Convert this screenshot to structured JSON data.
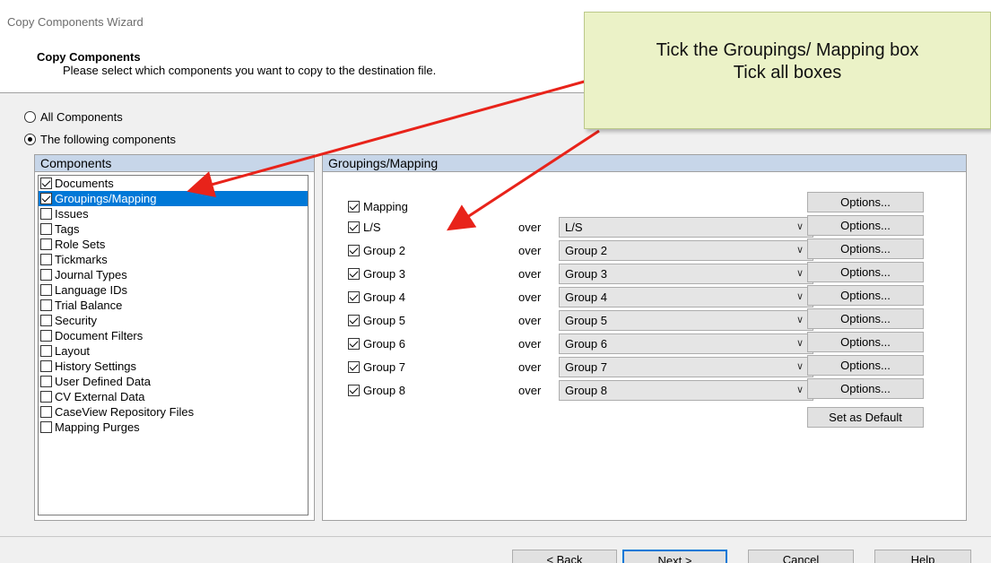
{
  "window": {
    "title": "Copy Components Wizard"
  },
  "header": {
    "heading": "Copy Components",
    "subheading": "Please select which components you want to copy to the destination file."
  },
  "scope": {
    "all_label": "All Components",
    "following_label": "The following components",
    "selected": "following"
  },
  "components": {
    "title": "Components",
    "items": [
      {
        "label": "Documents",
        "checked": true,
        "selected": false
      },
      {
        "label": "Groupings/Mapping",
        "checked": true,
        "selected": true
      },
      {
        "label": "Issues",
        "checked": false,
        "selected": false
      },
      {
        "label": "Tags",
        "checked": false,
        "selected": false
      },
      {
        "label": "Role Sets",
        "checked": false,
        "selected": false
      },
      {
        "label": "Tickmarks",
        "checked": false,
        "selected": false
      },
      {
        "label": "Journal Types",
        "checked": false,
        "selected": false
      },
      {
        "label": "Language IDs",
        "checked": false,
        "selected": false
      },
      {
        "label": "Trial Balance",
        "checked": false,
        "selected": false
      },
      {
        "label": "Security",
        "checked": false,
        "selected": false
      },
      {
        "label": "Document Filters",
        "checked": false,
        "selected": false
      },
      {
        "label": "Layout",
        "checked": false,
        "selected": false
      },
      {
        "label": "History Settings",
        "checked": false,
        "selected": false
      },
      {
        "label": "User Defined Data",
        "checked": false,
        "selected": false
      },
      {
        "label": "CV External Data",
        "checked": false,
        "selected": false
      },
      {
        "label": "CaseView Repository Files",
        "checked": false,
        "selected": false
      },
      {
        "label": "Mapping Purges",
        "checked": false,
        "selected": false
      }
    ]
  },
  "mapping": {
    "title": "Groupings/Mapping",
    "over_label": "over",
    "options_label": "Options...",
    "set_default_label": "Set as Default",
    "mapping_row": {
      "label": "Mapping",
      "checked": true
    },
    "rows": [
      {
        "label": "L/S",
        "checked": true,
        "over": "L/S"
      },
      {
        "label": "Group 2",
        "checked": true,
        "over": "Group 2"
      },
      {
        "label": "Group 3",
        "checked": true,
        "over": "Group 3"
      },
      {
        "label": "Group 4",
        "checked": true,
        "over": "Group 4"
      },
      {
        "label": "Group 5",
        "checked": true,
        "over": "Group 5"
      },
      {
        "label": "Group 6",
        "checked": true,
        "over": "Group 6"
      },
      {
        "label": "Group 7",
        "checked": true,
        "over": "Group 7"
      },
      {
        "label": "Group 8",
        "checked": true,
        "over": "Group 8"
      }
    ]
  },
  "footer": {
    "back_label": "< Back",
    "next_label": "Next >",
    "cancel_label": "Cancel",
    "help_label": "Help"
  },
  "callout": {
    "line1": "Tick the Groupings/ Mapping box",
    "line2": "Tick all boxes",
    "background": "#ebf2c7",
    "arrow_color": "#e8231a"
  },
  "colors": {
    "selection": "#0078d7",
    "panel_title_bg": "#c7d6e9"
  }
}
